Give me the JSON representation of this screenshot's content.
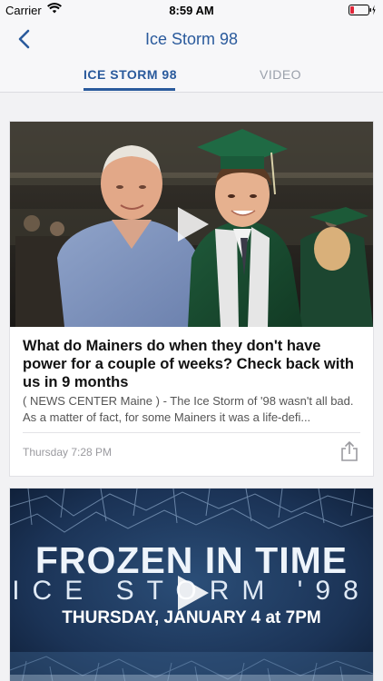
{
  "status_bar": {
    "carrier": "Carrier",
    "time": "8:59 AM",
    "icons": [
      "wifi-icon",
      "battery-icon",
      "charging-bolt-icon"
    ]
  },
  "nav": {
    "title": "Ice Storm 98",
    "back_icon": "chevron-left-icon",
    "accent_color": "#2a5a9c"
  },
  "tabs": [
    {
      "label": "ICE STORM 98",
      "active": true
    },
    {
      "label": "VIDEO",
      "active": false
    }
  ],
  "articles": [
    {
      "headline": "What do Mainers do when they don't have power for a couple of weeks? Check back with us in 9 months",
      "summary": "( NEWS CENTER Maine ) - The Ice Storm of '98 wasn't all bad. As a matter of fact, for some Mainers it was a life-defi...",
      "timestamp": "Thursday 7:28 PM",
      "has_video": true,
      "share_icon": "share-icon"
    },
    {
      "poster_title": "FROZEN IN TIME",
      "poster_subtitle": "ICE STORM '98",
      "poster_date": "THURSDAY, JANUARY 4 at 7PM",
      "has_video": true
    }
  ]
}
